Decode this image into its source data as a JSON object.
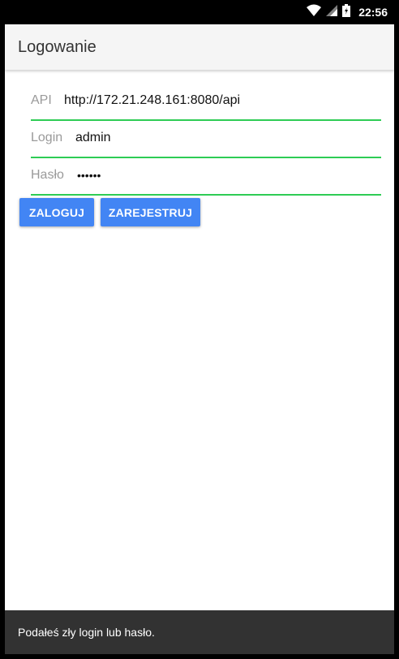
{
  "status_bar": {
    "time": "22:56",
    "icons": [
      "wifi-icon",
      "signal-icon",
      "battery-charging-icon"
    ]
  },
  "app_bar": {
    "title": "Logowanie"
  },
  "form": {
    "api": {
      "label": "API",
      "value": "http://172.21.248.161:8080/api"
    },
    "login": {
      "label": "Login",
      "value": "admin"
    },
    "password": {
      "label": "Hasło",
      "value": "••••••"
    }
  },
  "buttons": {
    "login": "ZALOGUJ",
    "register": "ZAREJESTRUJ"
  },
  "snackbar": {
    "message": "Podałeś zły login lub hasło."
  },
  "colors": {
    "accent": "#4285f4",
    "underline": "#2ecc55",
    "snackbar": "#323232"
  }
}
